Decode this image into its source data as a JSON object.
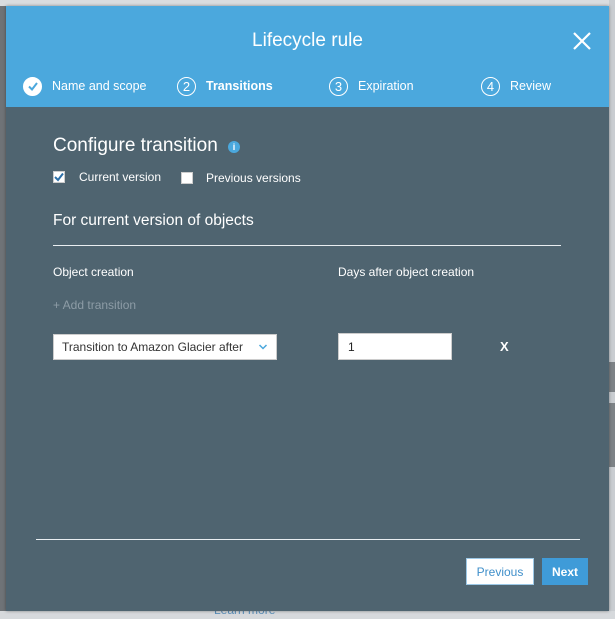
{
  "background": {
    "learn_more": "Learn more"
  },
  "modal": {
    "title": "Lifecycle rule",
    "steps": [
      {
        "number": "",
        "label": "Name and scope",
        "state": "done"
      },
      {
        "number": "2",
        "label": "Transitions",
        "state": "active"
      },
      {
        "number": "3",
        "label": "Expiration",
        "state": "pending"
      },
      {
        "number": "4",
        "label": "Review",
        "state": "pending"
      }
    ],
    "section_title": "Configure transition",
    "checkboxes": {
      "current": {
        "label": "Current version",
        "checked": true
      },
      "previous": {
        "label": "Previous versions",
        "checked": false
      }
    },
    "sub_title": "For current version of objects",
    "columns": {
      "object_creation": "Object creation",
      "days": "Days after object creation"
    },
    "add_transition": "+ Add transition",
    "transition_select": "Transition to Amazon Glacier after",
    "days_value": "1",
    "remove": "X",
    "buttons": {
      "previous": "Previous",
      "next": "Next"
    }
  },
  "colors": {
    "header": "#4ba8dd",
    "body": "#4f6470",
    "accent": "#3f9bd8"
  }
}
